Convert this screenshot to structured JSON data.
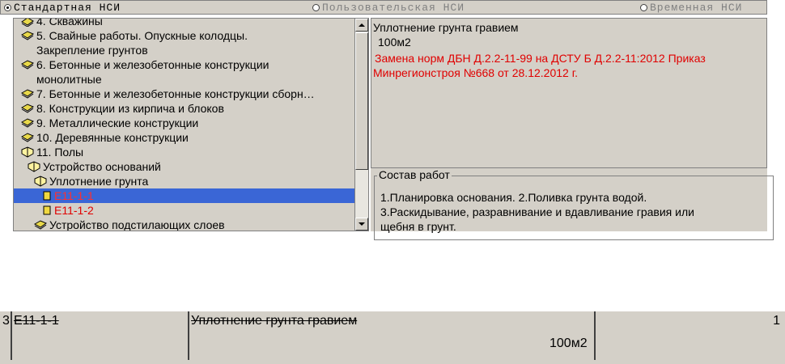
{
  "radio_options": [
    {
      "label": "Стандартная НСИ",
      "selected": true,
      "enabled": true
    },
    {
      "label": "Пользовательская НСИ",
      "selected": false,
      "enabled": false
    },
    {
      "label": "Временная НСИ",
      "selected": false,
      "enabled": false
    }
  ],
  "tree": {
    "items": [
      {
        "label": "4. Скважины",
        "icon": "book-icon",
        "state": "normal"
      },
      {
        "label": "5. Свайные работы. Опускные колодцы.",
        "icon": "book-icon",
        "state": "normal"
      },
      {
        "label": "Закрепление грунтов",
        "icon": "",
        "state": "normal"
      },
      {
        "label": "6. Бетонные и железобетонные конструкции",
        "icon": "book-icon",
        "state": "normal"
      },
      {
        "label": "монолитные",
        "icon": "",
        "state": "normal"
      },
      {
        "label": "7. Бетонные и железобетонные конструкции сборн…",
        "icon": "book-icon",
        "state": "normal"
      },
      {
        "label": "8. Конструкции из кирпича и блоков",
        "icon": "book-icon",
        "state": "normal"
      },
      {
        "label": "9. Металлические конструкции",
        "icon": "book-icon",
        "state": "normal"
      },
      {
        "label": "10. Деревянные конструкции",
        "icon": "book-icon",
        "state": "normal"
      },
      {
        "label": "11. Полы",
        "icon": "open-book-icon",
        "state": "normal"
      },
      {
        "label": "Устройство оснований",
        "icon": "open-book-icon",
        "state": "normal"
      },
      {
        "label": "Уплотнение грунта",
        "icon": "open-book-icon",
        "state": "normal"
      },
      {
        "label": "Е11-1-1",
        "icon": "item-icon",
        "state": "selected"
      },
      {
        "label": "Е11-1-2",
        "icon": "item-icon",
        "state": "red"
      },
      {
        "label": "Устройство подстилающих слоев",
        "icon": "book-icon",
        "state": "normal"
      }
    ]
  },
  "info": {
    "title": "Уплотнение грунта гравием",
    "unit": "100м2",
    "note_line1": "Замена норм ДБН Д.2.2-11-99 на ДСТУ Б Д.2.2-11:2012 Приказ",
    "note_line2": "Минрегионстроя №668 от 28.12.2012 г."
  },
  "sostav": {
    "legend": "Состав работ",
    "line1": "1.Планировка основания. 2.Поливка грунта водой.",
    "line2": "3.Раскидывание, разравнивание и вдавливание гравия или",
    "line3": "щебня в грунт."
  },
  "row": {
    "num": "3",
    "code": "Е11-1-1",
    "name": "Уплотнение грунта гравием",
    "unit": "100м2",
    "qty": "1"
  },
  "colors": {
    "panel": "#d4d0c8",
    "selection": "#3a66d6",
    "red_text": "#e00000"
  }
}
